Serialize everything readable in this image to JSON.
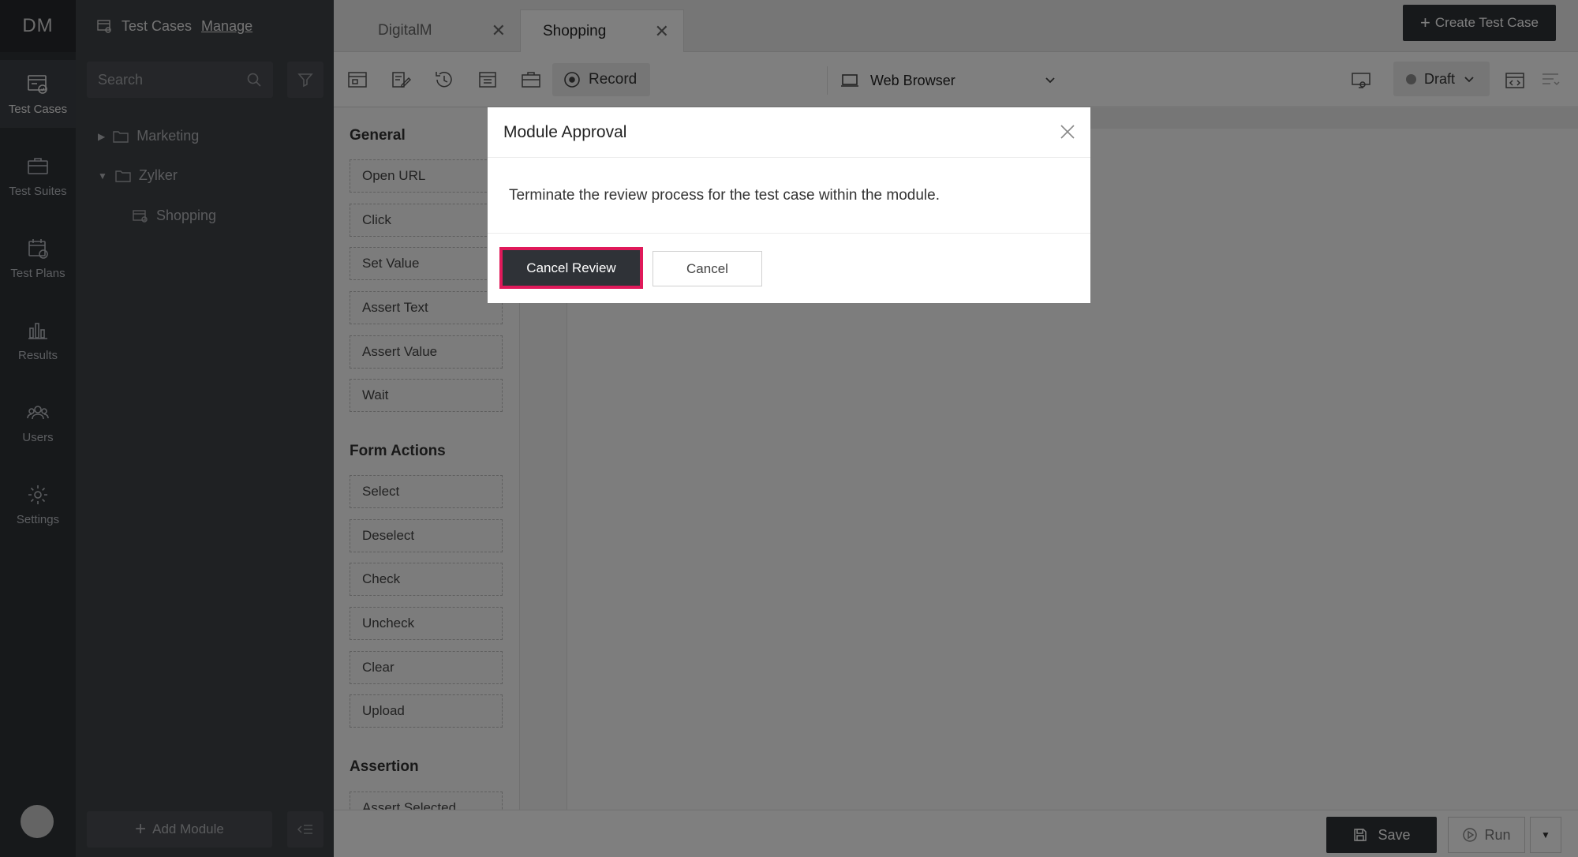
{
  "app": {
    "logo": "DM"
  },
  "rail": {
    "items": [
      {
        "label": "Test Cases"
      },
      {
        "label": "Test Suites"
      },
      {
        "label": "Test Plans"
      },
      {
        "label": "Results"
      },
      {
        "label": "Users"
      },
      {
        "label": "Settings"
      }
    ]
  },
  "tree": {
    "title": "Test Cases",
    "manage": "Manage",
    "search_placeholder": "Search",
    "nodes": [
      {
        "label": "Marketing"
      },
      {
        "label": "Zylker"
      },
      {
        "label": "Shopping"
      }
    ],
    "add_module": "Add Module"
  },
  "tabs": [
    {
      "label": "DigitalM"
    },
    {
      "label": "Shopping"
    }
  ],
  "header": {
    "create_button": "Create Test Case"
  },
  "toolbar": {
    "record": "Record",
    "browser": "Web Browser",
    "status": "Draft"
  },
  "palette": {
    "general_title": "General",
    "general": [
      "Open URL",
      "Click",
      "Set Value",
      "Assert Text",
      "Assert Value",
      "Wait"
    ],
    "form_title": "Form Actions",
    "form": [
      "Select",
      "Deselect",
      "Check",
      "Uncheck",
      "Clear",
      "Upload"
    ],
    "assertion_title": "Assertion",
    "assertion": [
      "Assert Selected"
    ]
  },
  "footer": {
    "save": "Save",
    "run": "Run"
  },
  "modal": {
    "title": "Module Approval",
    "message": "Terminate the review process for the test case within the module.",
    "primary": "Cancel Review",
    "secondary": "Cancel"
  },
  "colors": {
    "rail_bg": "#2f3237",
    "tree_bg": "#3f4247",
    "primary_button": "#2f3237",
    "highlight": "#e0195a"
  }
}
